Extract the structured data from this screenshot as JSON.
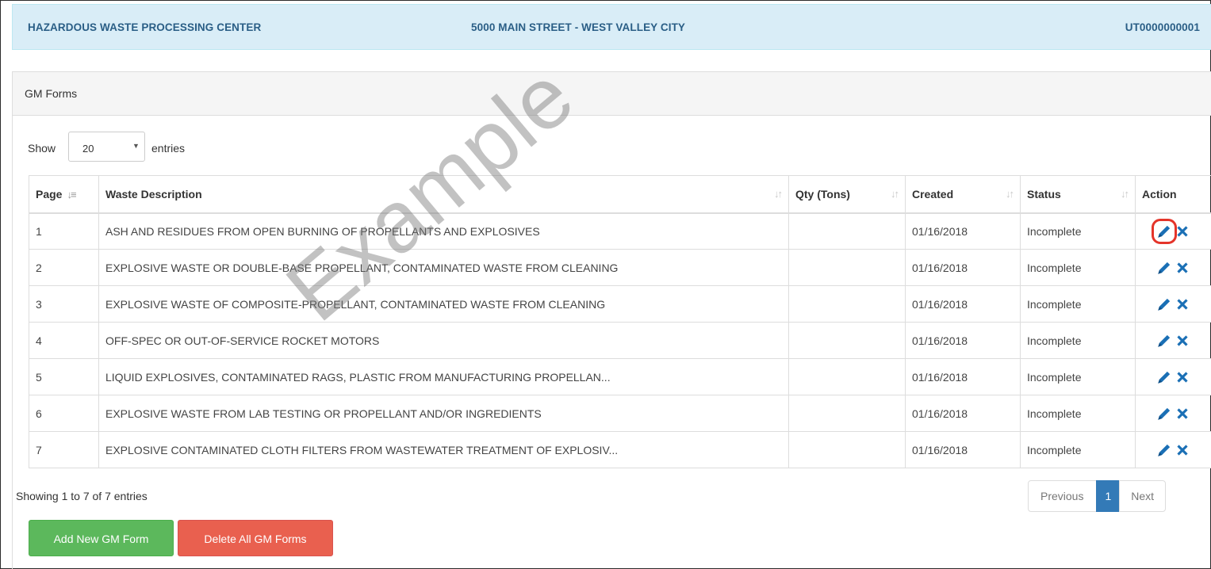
{
  "header": {
    "facility_name": "HAZARDOUS WASTE PROCESSING CENTER",
    "address": "5000 MAIN STREET - WEST VALLEY CITY",
    "epa_id": "UT0000000001"
  },
  "panel": {
    "title": "GM Forms"
  },
  "length_menu": {
    "show_label": "Show",
    "selected": "20",
    "entries_label": "entries"
  },
  "table": {
    "columns": [
      "Page",
      "Waste Description",
      "Qty (Tons)",
      "Created",
      "Status",
      "Action"
    ],
    "rows": [
      {
        "page": "1",
        "description": "ASH AND RESIDUES FROM OPEN BURNING OF PROPELLANTS AND EXPLOSIVES",
        "qty": "",
        "created": "01/16/2018",
        "status": "Incomplete"
      },
      {
        "page": "2",
        "description": "EXPLOSIVE WASTE OR DOUBLE-BASE PROPELLANT, CONTAMINATED WASTE FROM CLEANING",
        "qty": "",
        "created": "01/16/2018",
        "status": "Incomplete"
      },
      {
        "page": "3",
        "description": "EXPLOSIVE WASTE OF COMPOSITE-PROPELLANT, CONTAMINATED WASTE FROM CLEANING",
        "qty": "",
        "created": "01/16/2018",
        "status": "Incomplete"
      },
      {
        "page": "4",
        "description": "OFF-SPEC OR OUT-OF-SERVICE ROCKET MOTORS",
        "qty": "",
        "created": "01/16/2018",
        "status": "Incomplete"
      },
      {
        "page": "5",
        "description": "LIQUID EXPLOSIVES, CONTAMINATED RAGS, PLASTIC FROM MANUFACTURING PROPELLAN...",
        "qty": "",
        "created": "01/16/2018",
        "status": "Incomplete"
      },
      {
        "page": "6",
        "description": "EXPLOSIVE WASTE FROM LAB TESTING OR PROPELLANT AND/OR INGREDIENTS",
        "qty": "",
        "created": "01/16/2018",
        "status": "Incomplete"
      },
      {
        "page": "7",
        "description": "EXPLOSIVE CONTAMINATED CLOTH FILTERS FROM WASTEWATER TREATMENT OF EXPLOSIV...",
        "qty": "",
        "created": "01/16/2018",
        "status": "Incomplete"
      }
    ],
    "action_icons": [
      "pencil-icon",
      "times-icon"
    ]
  },
  "info": "Showing 1 to 7 of 7 entries",
  "pagination": {
    "previous": "Previous",
    "current": "1",
    "next": "Next"
  },
  "buttons": {
    "add": "Add New GM Form",
    "delete_all": "Delete All GM Forms"
  },
  "watermark": "Example",
  "colors": {
    "header_bg": "#d9edf7",
    "header_text": "#2a5e86",
    "icon_blue": "#1a6fb5",
    "add_green": "#5cb85c",
    "delete_red": "#e9604f",
    "page_active": "#337ab7",
    "highlight_red": "#e4342a"
  }
}
